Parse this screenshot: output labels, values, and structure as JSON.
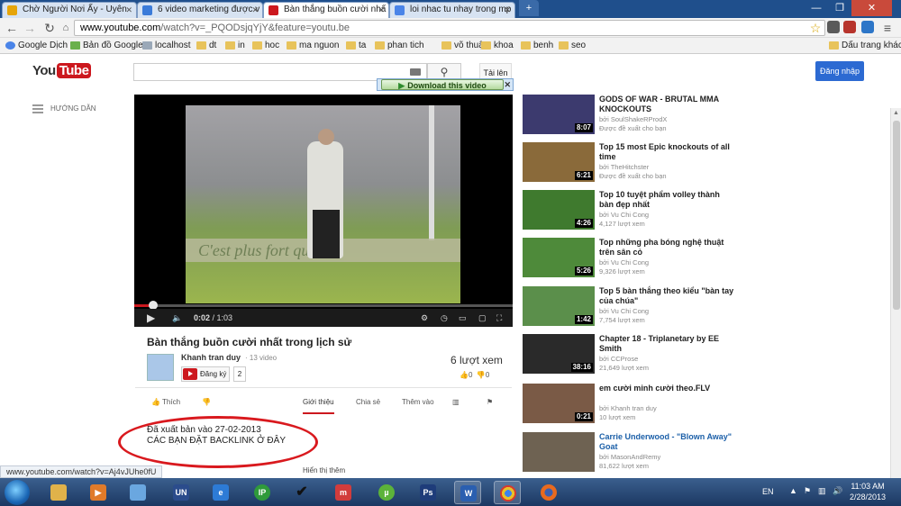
{
  "browser": {
    "tabs": [
      {
        "label": "Chờ Người Nơi Ấy - Uyên",
        "fav": "#e6a50a",
        "active": false
      },
      {
        "label": "6 video marketing được v",
        "fav": "#3b7bd9",
        "active": false
      },
      {
        "label": "Bàn thắng buồn cười nhấ",
        "fav": "#cc181e",
        "active": true
      },
      {
        "label": "loi nhac tu nhay trong mp",
        "fav": "#4a84e8",
        "active": false
      }
    ],
    "url_domain": "www.youtube.com",
    "url_rest": "/watch?v=_PQODsjqYjY&feature=youtu.be",
    "bookmarks": [
      "Google Dịch",
      "Bản đồ Google",
      "localhost",
      "dt",
      "in",
      "hoc",
      "ma nguon",
      "ta",
      "phan tich",
      "võ thuật",
      "khoa",
      "benh",
      "seo"
    ],
    "other_bookmarks": "Dấu trang khác"
  },
  "youtube": {
    "logo_you": "You",
    "logo_tube": "Tube",
    "upload": "Tải lên",
    "signin": "Đăng nhập",
    "guide": "HƯỚNG DẪN",
    "download": "Download this video",
    "player": {
      "current": "0:02",
      "total": "1:03",
      "progress": 0.05,
      "overlay_text": "C'est plus fort que toi"
    },
    "title": "Bàn thắng buồn cười nhất trong lịch sử",
    "channel": "Khanh tran duy",
    "video_count": "· 13 video",
    "subscribe": "Đăng ký",
    "sub_count": "2",
    "views": "6 lượt xem",
    "likes": "0",
    "dislikes": "0",
    "actions": {
      "like": "Thích",
      "about": "Giới thiệu",
      "share": "Chia sẻ",
      "add": "Thêm vào"
    },
    "published": "Đã xuất bản vào 27-02-2013",
    "description": "CÁC BẠN ĐẶT BACKLINK Ở ĐÂY",
    "show_more": "Hiển thị thêm"
  },
  "related": [
    {
      "title": "GODS OF WAR - BRUTAL MMA KNOCKOUTS",
      "by": "bởi SoulShakeRProdX",
      "meta": "Được đề xuất cho bạn",
      "dur": "8:07",
      "color": "#3c3a6e",
      "blue": false
    },
    {
      "title": "Top 15 most Epic knockouts of all time",
      "by": "bởi TheHitchster",
      "meta": "Được đề xuất cho bạn",
      "dur": "6:21",
      "color": "#8a6a3a",
      "blue": false
    },
    {
      "title": "Top 10 tuyệt phẩm volley thành bàn đẹp nhất",
      "by": "bởi Vu Chi Cong",
      "meta": "4,127 lượt xem",
      "dur": "4:26",
      "color": "#3f7a2e",
      "blue": false
    },
    {
      "title": "Top những pha bóng nghệ thuật trên sân cỏ",
      "by": "bởi Vu Chi Cong",
      "meta": "9,326 lượt xem",
      "dur": "5:26",
      "color": "#4e8a3a",
      "blue": false
    },
    {
      "title": "Top 5 bàn thắng theo kiểu \"bàn tay của chúa\"",
      "by": "bởi Vu Chi Cong",
      "meta": "7,754 lượt xem",
      "dur": "1:42",
      "color": "#5b8f4b",
      "blue": false
    },
    {
      "title": "Chapter 18 - Triplanetary by EE Smith",
      "by": "bởi CCProse",
      "meta": "21,649 lượt xem",
      "dur": "38:16",
      "color": "#2a2a2a",
      "blue": false
    },
    {
      "title": "em cười minh cười theo.FLV",
      "by": "bởi Khanh tran duy",
      "meta": "10 lượt xem",
      "dur": "0:21",
      "color": "#7a5a46",
      "blue": false
    },
    {
      "title": "Carrie Underwood - \"Blown Away\" Goat",
      "by": "bởi MasonAndRemy",
      "meta": "81,622 lượt xem",
      "dur": "",
      "color": "#6e6252",
      "blue": true
    }
  ],
  "status_url": "www.youtube.com/watch?v=Aj4vJUhe0fU",
  "taskbar": {
    "lang": "EN",
    "time": "11:03 AM",
    "date": "2/28/2013"
  }
}
